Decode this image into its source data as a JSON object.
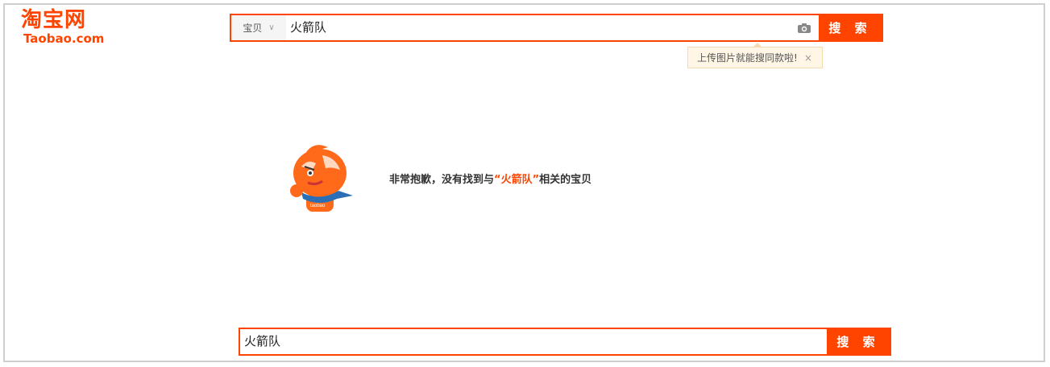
{
  "brand": {
    "name_cn": "淘宝网",
    "name_en": "Taobao.com",
    "color": "#ff4400"
  },
  "top_search": {
    "scope_label": "宝贝",
    "query": "火箭队",
    "button_label": "搜 索",
    "camera_icon": "camera-icon"
  },
  "tooltip": {
    "text": "上传图片就能搜同款啦!",
    "close": "×"
  },
  "no_result": {
    "prefix": "非常抱歉，没有找到与",
    "open_quote": "“",
    "keyword": "火箭队",
    "close_quote": "”",
    "suffix": "相关的宝贝"
  },
  "bottom_search": {
    "query": "火箭队",
    "button_label": "搜 索"
  }
}
